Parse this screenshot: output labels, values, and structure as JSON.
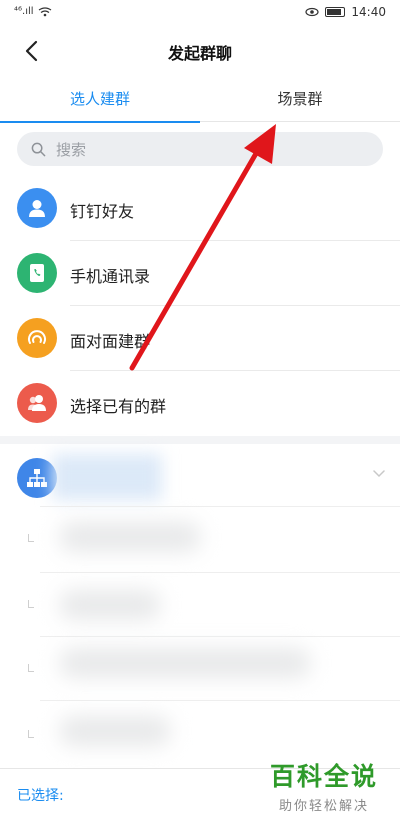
{
  "status_bar": {
    "signal": "⁴⁶.ıll",
    "time": "14:40"
  },
  "header": {
    "title": "发起群聊"
  },
  "tabs": [
    {
      "label": "选人建群",
      "active": true
    },
    {
      "label": "场景群",
      "active": false
    }
  ],
  "search": {
    "placeholder": "搜索"
  },
  "menu": [
    {
      "label": "钉钉好友",
      "icon": "person-icon",
      "color": "#3b8ff0"
    },
    {
      "label": "手机通讯录",
      "icon": "phone-book-icon",
      "color": "#2db472"
    },
    {
      "label": "面对面建群",
      "icon": "face-to-face-icon",
      "color": "#f5a020"
    },
    {
      "label": "选择已有的群",
      "icon": "group-icon",
      "color": "#ec5b4c"
    }
  ],
  "org": {
    "icon": "org-chart-icon",
    "color": "#3f86e8"
  },
  "footer": {
    "selected_label": "已选择:"
  },
  "watermark": {
    "main": "百科全说",
    "sub": "助你轻松解决"
  },
  "colors": {
    "accent": "#1a8cf0",
    "annotation_arrow": "#e0161b"
  }
}
